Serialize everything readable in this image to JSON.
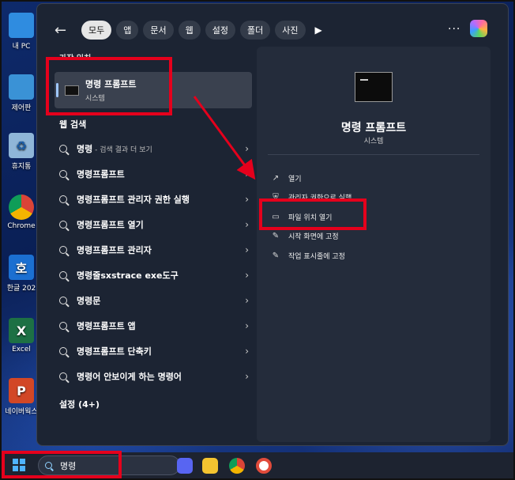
{
  "desktop": {
    "icons": [
      {
        "label": "내 PC",
        "name": "desktop-icon-my-pc",
        "glyph": "",
        "bg": "#2f8ce0"
      },
      {
        "label": "제어판",
        "name": "desktop-icon-control-panel",
        "glyph": "",
        "bg": "#3a92d6"
      },
      {
        "label": "휴지통",
        "name": "desktop-icon-recycle-bin",
        "glyph": "♻",
        "bg": "#8fb6d8"
      },
      {
        "label": "Chrome",
        "name": "desktop-icon-chrome",
        "glyph": "",
        "bg": "#ffffff"
      },
      {
        "label": "한글 202",
        "name": "desktop-icon-hangul",
        "glyph": "호",
        "bg": "#1b6fd1"
      },
      {
        "label": "Excel",
        "name": "desktop-icon-excel",
        "glyph": "X",
        "bg": "#1d7044"
      },
      {
        "label": "네이버웍스",
        "name": "desktop-icon-powerpoint",
        "glyph": "P",
        "bg": "#d24726"
      }
    ]
  },
  "filters": {
    "back": "←",
    "chips": [
      "모두",
      "앱",
      "문서",
      "웹",
      "설정",
      "폴더",
      "사진"
    ],
    "play": "▶",
    "more": "···"
  },
  "left": {
    "best_match_heading": "가장 일치",
    "best_match_title": "명령 프롬프트",
    "best_match_sub": "시스템",
    "web_heading": "웹 검색",
    "web_items": [
      {
        "text": "명령",
        "sub": " - 검색 결과 더 보기"
      },
      {
        "text": "명령프롬프트",
        "sub": ""
      },
      {
        "text": "명령프롬프트 관리자 권한 실행",
        "sub": ""
      },
      {
        "text": "명령프롬프트 열기",
        "sub": ""
      },
      {
        "text": "명령프롬프트 관리자",
        "sub": ""
      },
      {
        "text": "명령줄sxstrace exe도구",
        "sub": ""
      },
      {
        "text": "명령문",
        "sub": ""
      },
      {
        "text": "명령프롬프트 앱",
        "sub": ""
      },
      {
        "text": "명령프롬프트 단축키",
        "sub": ""
      },
      {
        "text": "명령어 안보이게 하는 명령어",
        "sub": ""
      }
    ],
    "settings_heading": "설정 (4+)",
    "chevron": "›"
  },
  "detail": {
    "title": "명령 프롬프트",
    "subtitle": "시스템",
    "actions": [
      {
        "label": "열기",
        "icon": "↗",
        "name": "action-open"
      },
      {
        "label": "관리자 권한으로 실행",
        "icon": "⛨",
        "name": "action-run-as-admin"
      },
      {
        "label": "파일 위치 열기",
        "icon": "▭",
        "name": "action-open-file-location"
      },
      {
        "label": "시작 화면에 고정",
        "icon": "✎",
        "name": "action-pin-to-start"
      },
      {
        "label": "작업 표시줄에 고정",
        "icon": "✎",
        "name": "action-pin-to-taskbar"
      }
    ]
  },
  "taskbar": {
    "search_value": "명령",
    "icons": [
      {
        "name": "discord-icon",
        "bg": "#5865f2"
      },
      {
        "name": "file-explorer-icon",
        "bg": "#f4c430"
      },
      {
        "name": "chrome-icon",
        "bg": "#ffffff"
      },
      {
        "name": "app-icon",
        "bg": "#222222"
      }
    ]
  },
  "colors": {
    "annotation_red": "#e5001c",
    "accent_blue": "#4fb3ff"
  }
}
